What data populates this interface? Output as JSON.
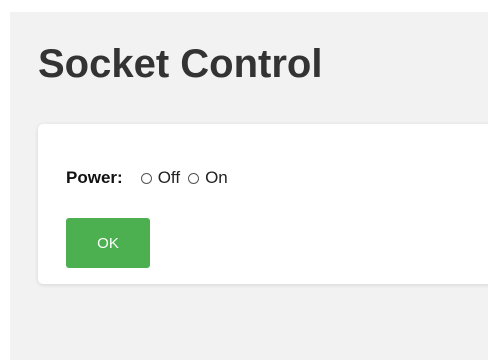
{
  "header": {
    "title": "Socket Control"
  },
  "form": {
    "power_label": "Power:",
    "options": [
      {
        "label": "Off",
        "checked": false
      },
      {
        "label": "On",
        "checked": false
      }
    ],
    "ok_label": "OK"
  },
  "colors": {
    "page_background": "#f2f2f2",
    "card_background": "#ffffff",
    "button_green": "#4caf50"
  }
}
